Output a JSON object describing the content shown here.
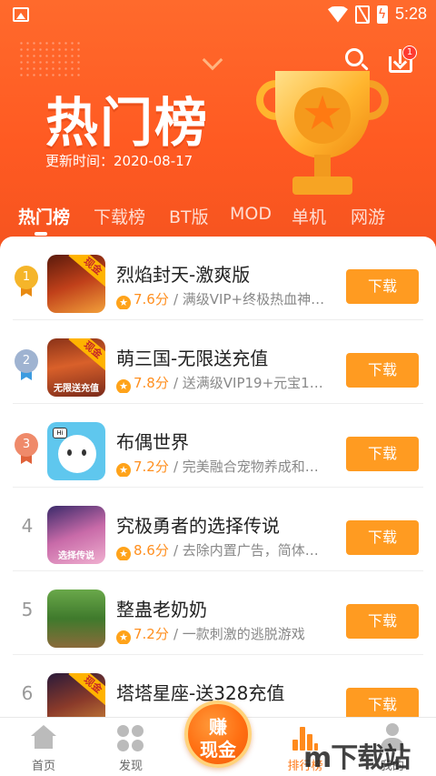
{
  "status_bar": {
    "time": "5:28"
  },
  "header": {
    "title": "热门榜",
    "update_label": "更新时间：",
    "update_date": "2020-08-17",
    "download_badge": "1"
  },
  "tabs": [
    {
      "label": "热门榜",
      "active": true
    },
    {
      "label": "下载榜"
    },
    {
      "label": "BT版"
    },
    {
      "label": "MOD"
    },
    {
      "label": "单机"
    },
    {
      "label": "网游"
    }
  ],
  "games": [
    {
      "rank": "1",
      "title": "烈焰封天-激爽版",
      "score": "7.6分",
      "desc": "/ 满级VIP+终极热血神…",
      "button": "下载",
      "icon_tag": "现金",
      "icon_caption": ""
    },
    {
      "rank": "2",
      "title": "萌三国-无限送充值",
      "score": "7.8分",
      "desc": "/ 送满级VIP19+元宝1…",
      "button": "下载",
      "icon_tag": "现金",
      "icon_caption": "无限送充值"
    },
    {
      "rank": "3",
      "title": "布偶世界",
      "score": "7.2分",
      "desc": "/ 完美融合宠物养成和…",
      "button": "下载",
      "icon_tag": "",
      "icon_caption": ""
    },
    {
      "rank": "4",
      "title": "究极勇者的选择传说",
      "score": "8.6分",
      "desc": "/ 去除内置广告，简体…",
      "button": "下载",
      "icon_tag": "",
      "icon_caption": "选择传说"
    },
    {
      "rank": "5",
      "title": "整蛊老奶奶",
      "score": "7.2分",
      "desc": "/ 一款刺激的逃脱游戏",
      "button": "下载",
      "icon_tag": "",
      "icon_caption": ""
    },
    {
      "rank": "6",
      "title": "塔塔星座-送328充值",
      "score": "",
      "desc": "",
      "button": "下载",
      "icon_tag": "现金",
      "icon_caption": ""
    }
  ],
  "bottom_nav": [
    {
      "label": "首页"
    },
    {
      "label": "发现"
    },
    {
      "label": "排行榜",
      "active": true
    },
    {
      "label": "我的"
    }
  ],
  "earn_button": {
    "line1": "赚",
    "line2": "现金"
  },
  "watermark": "m下载站",
  "colors": {
    "accent": "#ff9b21",
    "header": "#ff5a22",
    "gold": "#f5b52a",
    "silver": "#9fb3d1",
    "bronze": "#ef8a6a"
  }
}
